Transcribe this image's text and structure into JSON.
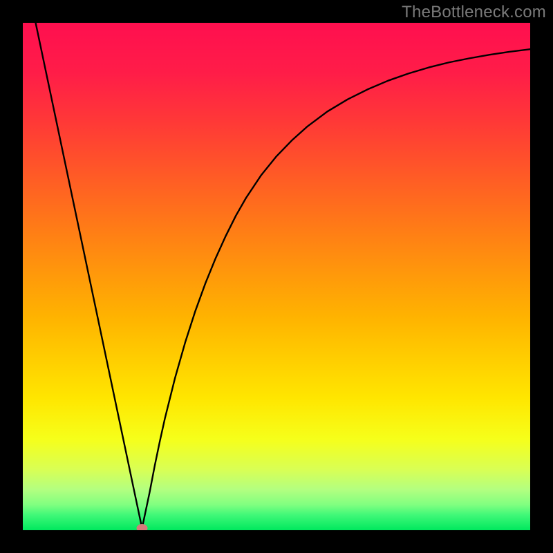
{
  "watermark": "TheBottleneck.com",
  "chart_data": {
    "type": "line",
    "title": "",
    "xlabel": "",
    "ylabel": "",
    "xlim": [
      0,
      100
    ],
    "ylim": [
      0,
      100
    ],
    "grid": false,
    "series": [
      {
        "name": "curve",
        "x": [
          0,
          2,
          4,
          6,
          8,
          10,
          12,
          14,
          16,
          18,
          20,
          22,
          23.5,
          25,
          26,
          27,
          28,
          30,
          32,
          34,
          36,
          38,
          40,
          42,
          44,
          47,
          50,
          53,
          56,
          60,
          64,
          68,
          72,
          76,
          80,
          84,
          88,
          92,
          96,
          100
        ],
        "y": [
          112,
          102.5,
          93,
          83.5,
          74,
          64.5,
          55,
          45.5,
          36,
          26.5,
          17,
          7.5,
          0.4,
          7.5,
          12.7,
          17.5,
          22,
          30,
          37,
          43.2,
          48.7,
          53.6,
          58,
          62,
          65.5,
          70,
          73.7,
          76.8,
          79.5,
          82.5,
          84.9,
          86.9,
          88.6,
          90,
          91.2,
          92.2,
          93,
          93.7,
          94.3,
          94.8
        ]
      }
    ],
    "marker": {
      "name": "optimum-marker",
      "x": 23.5,
      "y": 0.4,
      "color": "#d47a7a"
    },
    "gradient_stops": [
      {
        "offset": 0,
        "color": "#ff0f4f"
      },
      {
        "offset": 10,
        "color": "#ff1d48"
      },
      {
        "offset": 20,
        "color": "#ff3a36"
      },
      {
        "offset": 30,
        "color": "#ff5a26"
      },
      {
        "offset": 40,
        "color": "#ff7a17"
      },
      {
        "offset": 50,
        "color": "#ff9a0a"
      },
      {
        "offset": 58,
        "color": "#ffb300"
      },
      {
        "offset": 66,
        "color": "#ffcd00"
      },
      {
        "offset": 74,
        "color": "#ffe600"
      },
      {
        "offset": 82,
        "color": "#f6ff1a"
      },
      {
        "offset": 88,
        "color": "#d9ff54"
      },
      {
        "offset": 92,
        "color": "#b3ff80"
      },
      {
        "offset": 95,
        "color": "#80ff80"
      },
      {
        "offset": 97,
        "color": "#40f878"
      },
      {
        "offset": 100,
        "color": "#00e85e"
      }
    ]
  }
}
